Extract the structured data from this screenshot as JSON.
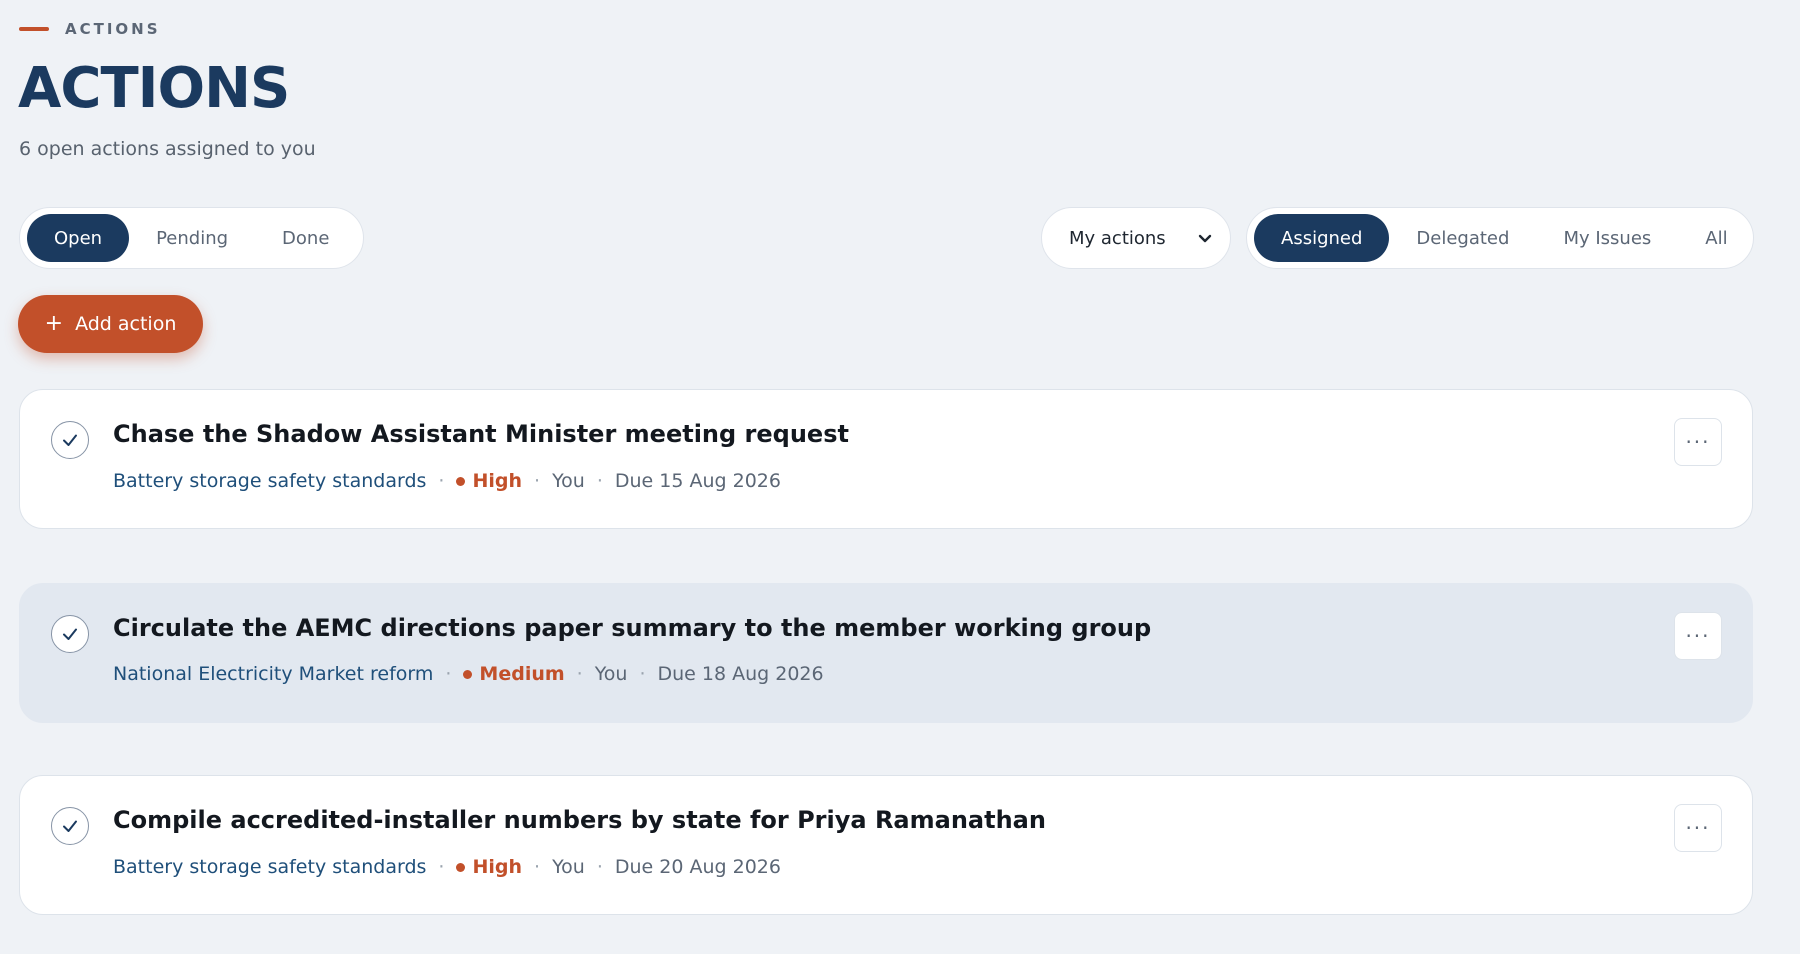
{
  "header": {
    "eyebrow": "ACTIONS",
    "title": "ACTIONS",
    "subtitle": "6 open actions assigned to you"
  },
  "status_tabs": [
    {
      "label": "Open",
      "active": true
    },
    {
      "label": "Pending",
      "active": false
    },
    {
      "label": "Done",
      "active": false
    }
  ],
  "owner_select": {
    "value": "My actions",
    "icon": "chevron-down-icon"
  },
  "scope_tabs": [
    {
      "label": "Assigned",
      "active": true
    },
    {
      "label": "Delegated",
      "active": false
    },
    {
      "label": "My Issues",
      "active": false
    },
    {
      "label": "All",
      "active": false
    }
  ],
  "add_button": {
    "icon": "+",
    "label": "Add action"
  },
  "actions": [
    {
      "title": "Chase the Shadow Assistant Minister meeting request",
      "issue": "Battery storage safety standards",
      "priority": "High",
      "owner": "You",
      "due": "Due 15 Aug 2026",
      "more": "···"
    },
    {
      "title": "Circulate the AEMC directions paper summary to the member working group",
      "issue": "National Electricity Market reform",
      "priority": "Medium",
      "owner": "You",
      "due": "Due 18 Aug 2026",
      "more": "···"
    },
    {
      "title": "Compile accredited-installer numbers by state for Priya Ramanathan",
      "issue": "Battery storage safety standards",
      "priority": "High",
      "owner": "You",
      "due": "Due 20 Aug 2026",
      "more": "···"
    }
  ],
  "separator": "·",
  "colors": {
    "accent": "#c2502a",
    "navy": "#1b3a5f",
    "background": "#eff2f6"
  }
}
